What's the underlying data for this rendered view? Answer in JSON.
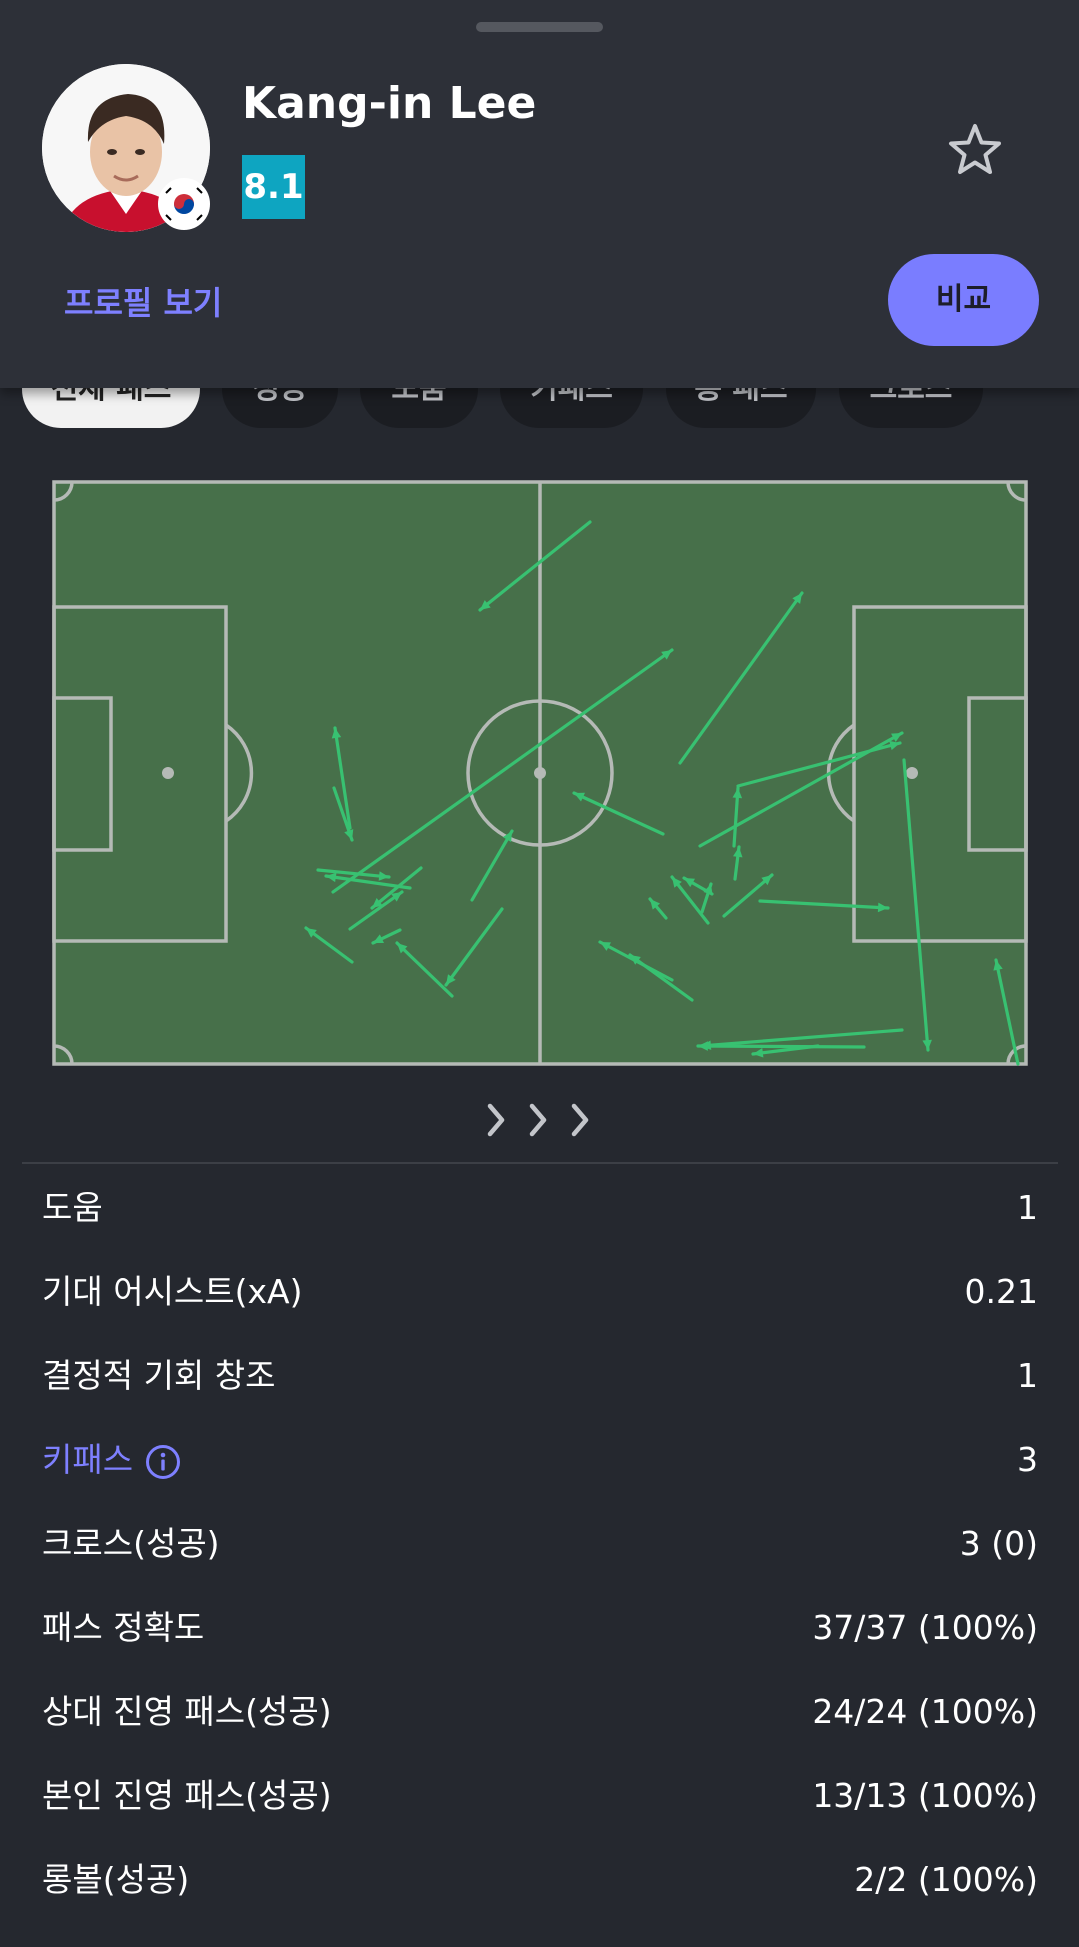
{
  "player": {
    "name": "Kang-in Lee",
    "rating": "8.1",
    "rating_color": "#0ea5c1",
    "flag_icon": "south-korea-flag-icon"
  },
  "actions": {
    "profile_link": "프로필 보기",
    "compare_button": "비교",
    "favorite_icon": "star-outline-icon"
  },
  "filter_chips": [
    {
      "label": "전체 패스",
      "active": true
    },
    {
      "label": "성공",
      "active": false
    },
    {
      "label": "도움",
      "active": false
    },
    {
      "label": "키패스",
      "active": false
    },
    {
      "label": "롱 패스",
      "active": false
    },
    {
      "label": "크로스",
      "active": false
    }
  ],
  "pitch": {
    "colors": {
      "grass": "#47704a",
      "lines": "#b5bab6",
      "pass": "#38c171"
    },
    "attack_direction_icon": "chevrons-right-icon"
  },
  "stats": [
    {
      "label": "도움",
      "value": "1",
      "link": false
    },
    {
      "label": "기대 어시스트(xA)",
      "value": "0.21",
      "link": false
    },
    {
      "label": "결정적 기회 창조",
      "value": "1",
      "link": false
    },
    {
      "label": "키패스",
      "value": "3",
      "link": true
    },
    {
      "label": "크로스(성공)",
      "value": "3 (0)",
      "link": false
    },
    {
      "label": "패스 정확도",
      "value": "37/37 (100%)",
      "link": false
    },
    {
      "label": "상대 진영 패스(성공)",
      "value": "24/24 (100%)",
      "link": false
    },
    {
      "label": "본인 진영 패스(성공)",
      "value": "13/13 (100%)",
      "link": false
    },
    {
      "label": "롱볼(성공)",
      "value": "2/2 (100%)",
      "link": false
    }
  ]
}
